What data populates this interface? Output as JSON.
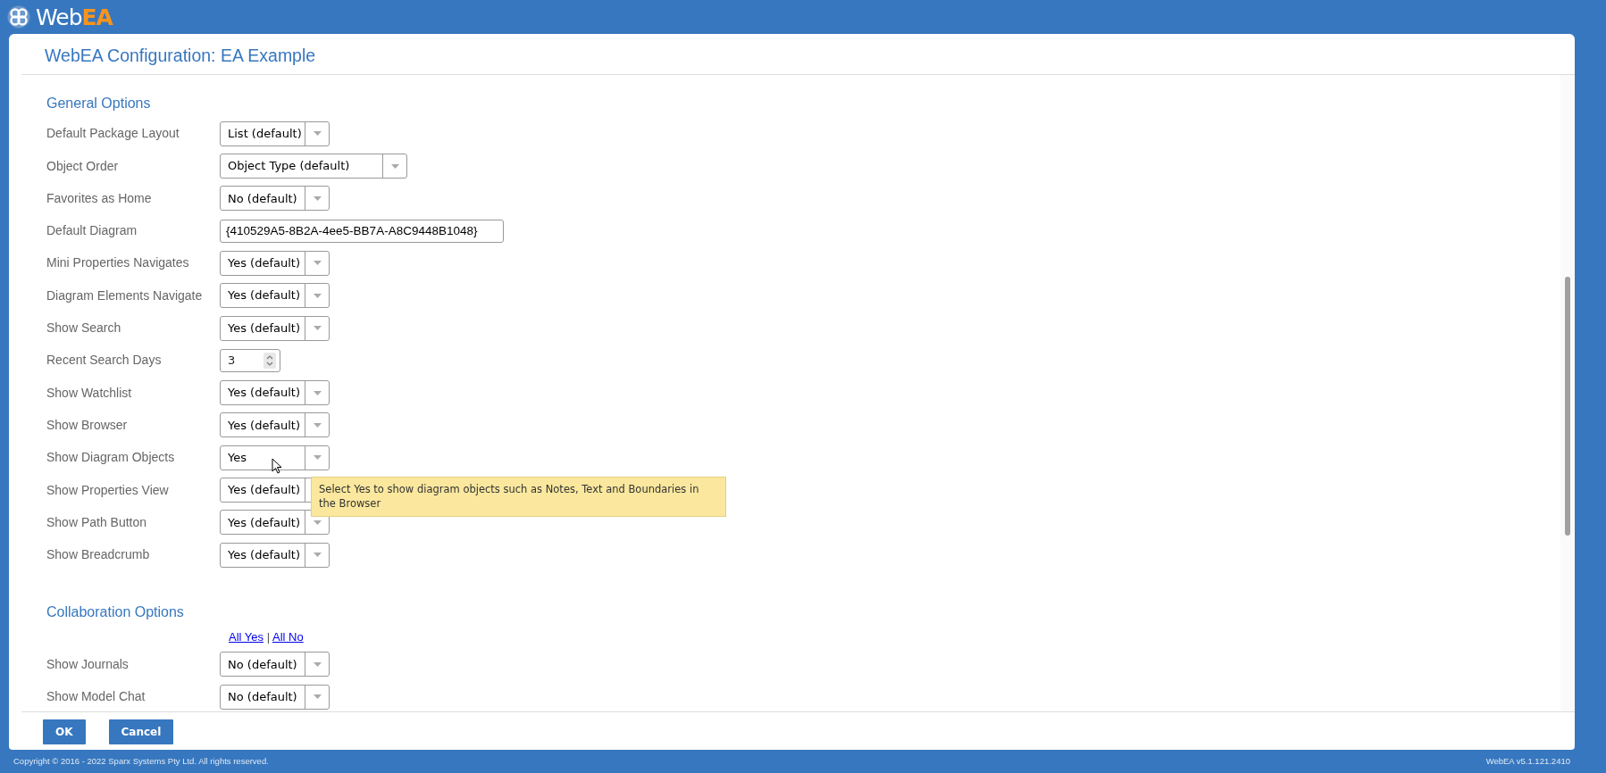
{
  "header": {
    "logo_parts": [
      "Web",
      "EA"
    ]
  },
  "page": {
    "title": "WebEA Configuration: EA Example"
  },
  "sections": [
    {
      "title": "General Options",
      "options": [
        {
          "label": "Default Package Layout",
          "kind": "select",
          "value": "List (default)",
          "wide": false
        },
        {
          "label": "Object Order",
          "kind": "select",
          "value": "Object Type (default)",
          "wide": true
        },
        {
          "label": "Favorites as Home",
          "kind": "select",
          "value": "No (default)",
          "wide": false
        },
        {
          "label": "Default Diagram",
          "kind": "text",
          "value": "{410529A5-8B2A-4ee5-BB7A-A8C9448B1048}"
        },
        {
          "label": "Mini Properties Navigates",
          "kind": "select",
          "value": "Yes (default)",
          "wide": false
        },
        {
          "label": "Diagram Elements Navigate",
          "kind": "select",
          "value": "Yes (default)",
          "wide": false
        },
        {
          "label": "Show Search",
          "kind": "select",
          "value": "Yes (default)",
          "wide": false
        },
        {
          "label": "Recent Search Days",
          "kind": "number",
          "value": "3"
        },
        {
          "label": "Show Watchlist",
          "kind": "select",
          "value": "Yes (default)",
          "wide": false
        },
        {
          "label": "Show Browser",
          "kind": "select",
          "value": "Yes (default)",
          "wide": false
        },
        {
          "label": "Show Diagram Objects",
          "kind": "select",
          "value": "Yes",
          "wide": false,
          "tooltip": "Select Yes to show diagram objects such as Notes, Text and Boundaries in the Browser"
        },
        {
          "label": "Show Properties View",
          "kind": "select",
          "value": "Yes (default)",
          "wide": false
        },
        {
          "label": "Show Path Button",
          "kind": "select",
          "value": "Yes (default)",
          "wide": false
        },
        {
          "label": "Show Breadcrumb",
          "kind": "select",
          "value": "Yes (default)",
          "wide": false
        }
      ]
    },
    {
      "title": "Collaboration Options",
      "links": [
        "All Yes",
        "|",
        "All No"
      ],
      "options": [
        {
          "label": "Show Journals",
          "kind": "select",
          "value": "No (default)",
          "wide": false
        },
        {
          "label": "Show Model Chat",
          "kind": "select",
          "value": "No (default)",
          "wide": false
        }
      ]
    }
  ],
  "buttons": [
    "OK",
    "Cancel"
  ],
  "footer": {
    "copyright": "Copyright © 2016 - 2022 Sparx Systems Pty Ltd. All rights reserved.",
    "version": "WebEA v5.1.121.2410"
  }
}
